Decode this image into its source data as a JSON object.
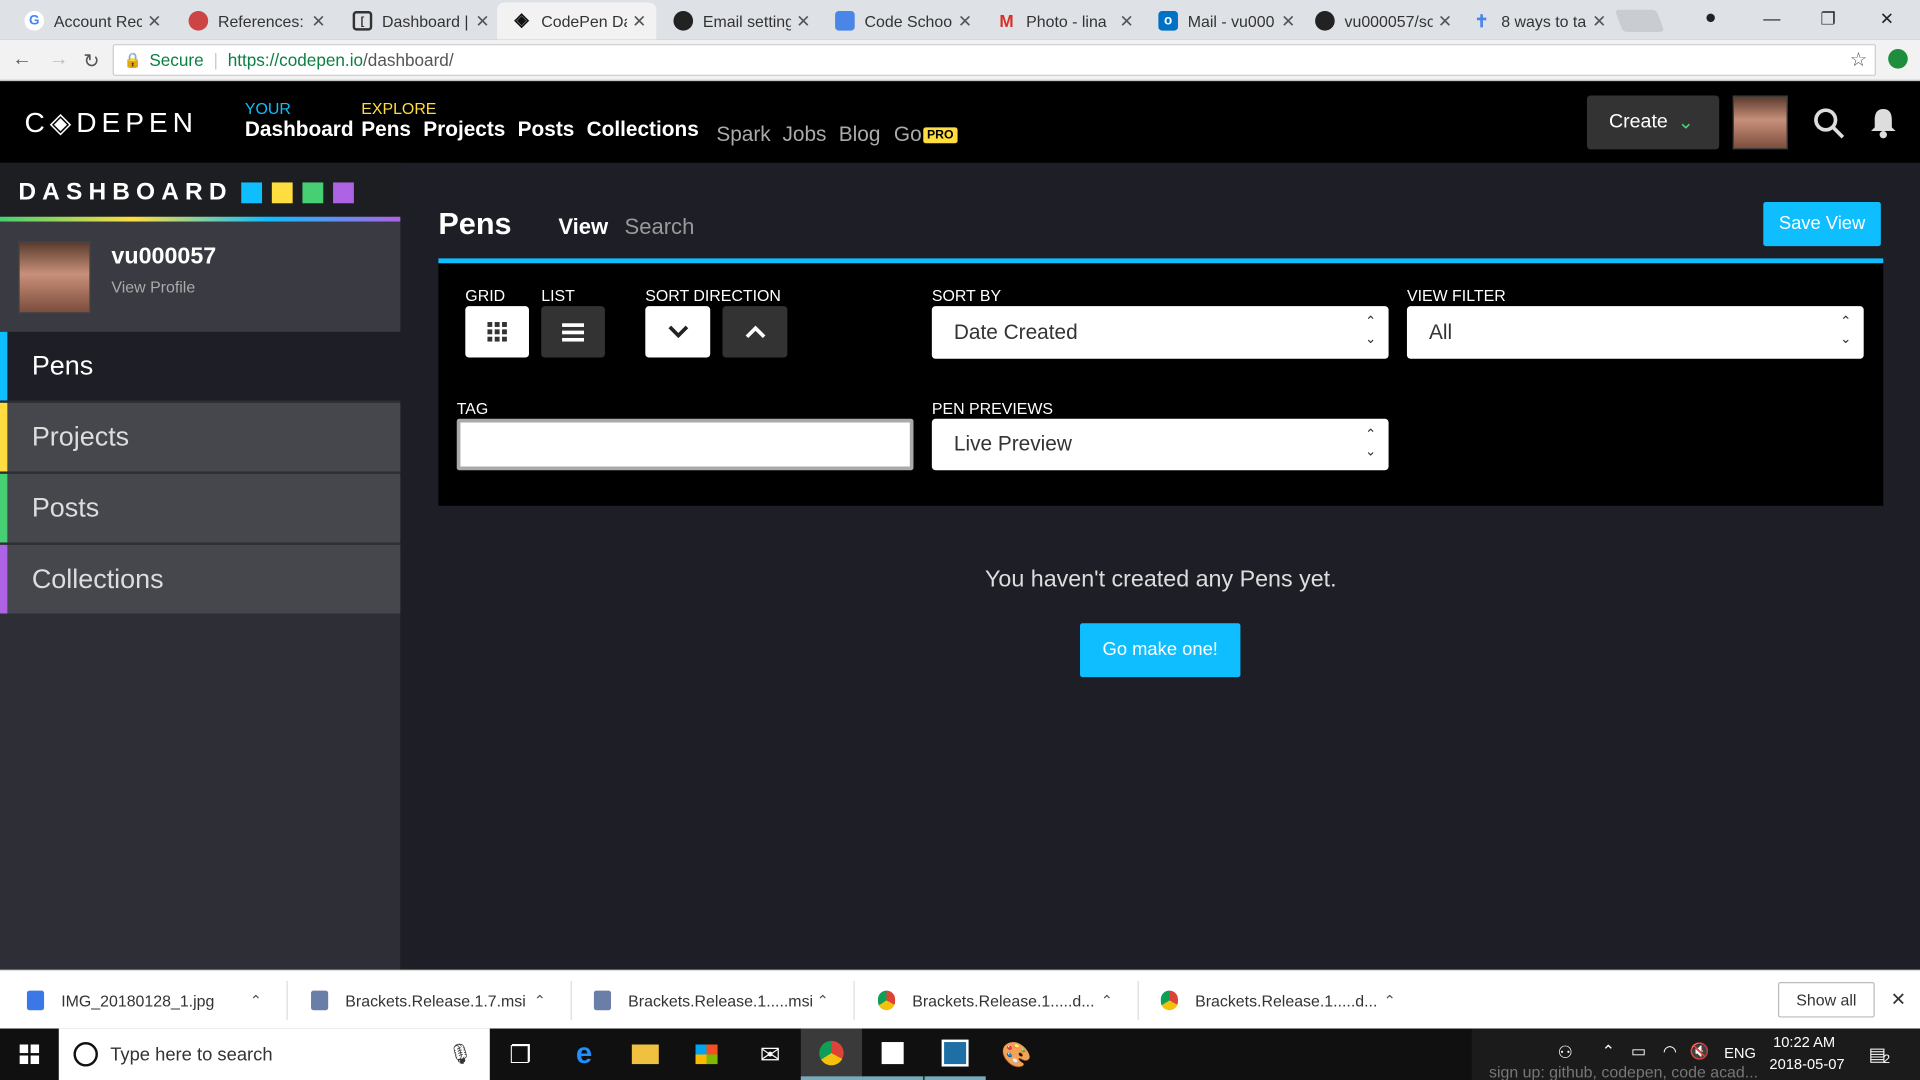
{
  "browser": {
    "tabs": [
      {
        "title": "Account Rec",
        "icon": "google-icon"
      },
      {
        "title": "References: F",
        "icon": "references-icon"
      },
      {
        "title": "Dashboard |",
        "icon": "codepen-doc-icon"
      },
      {
        "title": "CodePen Da",
        "icon": "codepen-icon"
      },
      {
        "title": "Email setting",
        "icon": "github-icon"
      },
      {
        "title": "Code School",
        "icon": "docs-icon"
      },
      {
        "title": "Photo - lina",
        "icon": "gmail-icon"
      },
      {
        "title": "Mail - vu000",
        "icon": "outlook-icon"
      },
      {
        "title": "vu000057/sc",
        "icon": "github-icon"
      },
      {
        "title": "8 ways to ta",
        "icon": "pin-icon"
      }
    ],
    "secure_label": "Secure",
    "url_host": "https://codepen.io",
    "url_path": "/dashboard/"
  },
  "header": {
    "logo": "C◈DEPEN",
    "your_label": "YOUR",
    "dashboard_link": "Dashboard",
    "explore_label": "EXPLORE",
    "nav": [
      "Pens",
      "Projects",
      "Posts",
      "Collections"
    ],
    "secondary_nav": [
      "Spark",
      "Jobs",
      "Blog",
      "Go"
    ],
    "pro_badge": "PRO",
    "create_label": "Create"
  },
  "sidebar": {
    "title": "DASHBOARD",
    "username": "vu000057",
    "view_profile": "View Profile",
    "items": [
      {
        "label": "Pens",
        "color": "#0ebeff"
      },
      {
        "label": "Projects",
        "color": "#ffdd40"
      },
      {
        "label": "Posts",
        "color": "#47cf73"
      },
      {
        "label": "Collections",
        "color": "#ae63e4"
      }
    ]
  },
  "main": {
    "title": "Pens",
    "tab_view": "View",
    "tab_search": "Search",
    "save_view": "Save View",
    "grid_label": "GRID",
    "list_label": "LIST",
    "sort_direction_label": "SORT DIRECTION",
    "sort_by_label": "SORT BY",
    "sort_by_value": "Date Created",
    "view_filter_label": "VIEW FILTER",
    "view_filter_value": "All",
    "tag_label": "TAG",
    "tag_value": "",
    "pen_previews_label": "PEN PREVIEWS",
    "pen_previews_value": "Live Preview",
    "empty_message": "You haven't created any Pens yet.",
    "cta": "Go make one!"
  },
  "downloads": {
    "items": [
      "IMG_20180128_1.jpg",
      "Brackets.Release.1.7.msi",
      "Brackets.Release.1.....msi",
      "Brackets.Release.1.....d...",
      "Brackets.Release.1.....d..."
    ],
    "show_all": "Show all"
  },
  "taskbar": {
    "search_placeholder": "Type here to search",
    "lang": "ENG",
    "time": "10:22 AM",
    "date": "2018-05-07",
    "notif_count": "2",
    "overlay_text": "sign up: github, codepen, code acad..."
  },
  "colors": {
    "accent": "#0ebeff",
    "yellow": "#ffdd40",
    "green": "#47cf73",
    "purple": "#ae63e4"
  }
}
